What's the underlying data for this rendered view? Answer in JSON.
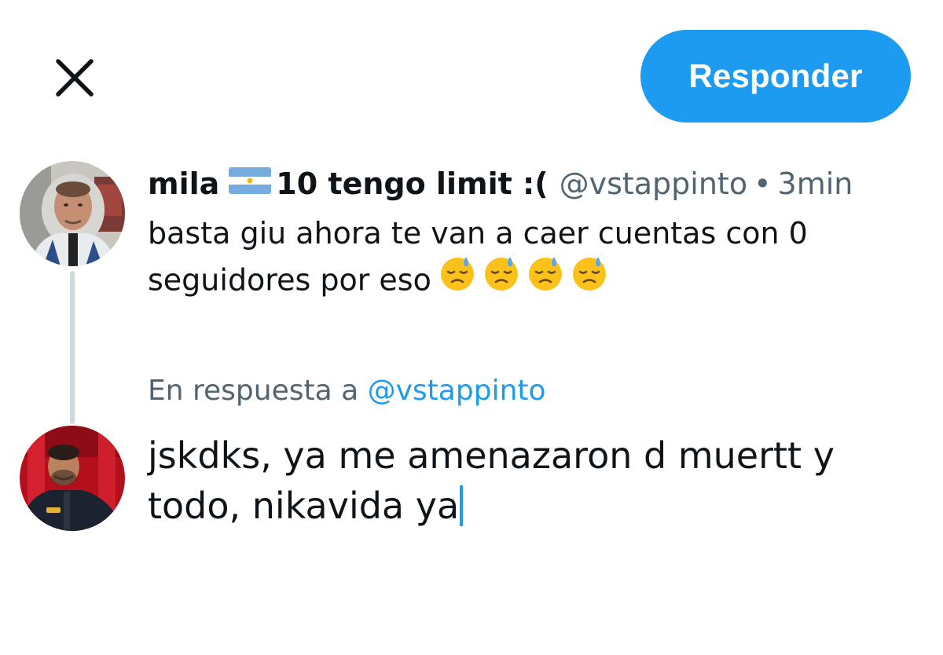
{
  "header": {
    "reply_button_label": "Responder"
  },
  "original_tweet": {
    "display_name": "mila",
    "flag_icon": "argentina-flag-icon",
    "display_name_suffix": "10 tengo limit :(",
    "handle": "@vstappinto",
    "separator": "•",
    "time": "3min",
    "text": "basta giu ahora te van a caer cuentas con 0 seguidores por eso",
    "emojis": [
      "downcast-face-with-sweat-emoji",
      "downcast-face-with-sweat-emoji",
      "downcast-face-with-sweat-emoji",
      "downcast-face-with-sweat-emoji"
    ]
  },
  "reply": {
    "replying_to_label": "En respuesta a",
    "replying_to_handle": "@vstappinto",
    "draft_text": "jskdks, ya me amenazaron d muertt y todo, nikavida ya"
  },
  "colors": {
    "accent": "#1d9bf0",
    "text_primary": "#0f1419",
    "text_secondary": "#536471",
    "thread_line": "#cfd9de"
  }
}
